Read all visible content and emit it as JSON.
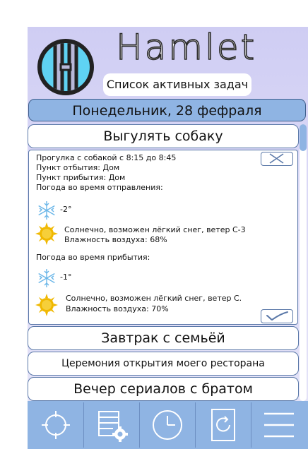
{
  "app": {
    "title": "Hamlet",
    "subtitle": "Список активных задач"
  },
  "date": "Понедельник, 28 фефраля",
  "tasks": [
    {
      "title": "Выгулять собаку",
      "expanded": true
    },
    {
      "title": "Завтрак с семьёй"
    },
    {
      "title": "Церемония открытия моего ресторана"
    },
    {
      "title": "Вечер сериалов с братом"
    }
  ],
  "details": {
    "line1": "Прогулка с собакой с 8:15 до 8:45",
    "line2": "Пункт отбытия: Дом",
    "line3": "Пункт прибытия: Дом",
    "departure_label": "Погода во время отправления:",
    "departure_temp": "-2°",
    "departure_desc": "Солнечно, возможен лёгкий снег, ветер С-3",
    "departure_humidity": "Влажность воздуха: 68%",
    "arrival_label": "Погода во время прибытия:",
    "arrival_temp": "-1°",
    "arrival_desc": "Солнечно, возможен лёгкий снег, ветер С.",
    "arrival_humidity": "Влажность воздуха: 70%"
  },
  "icons": {
    "close": "close-icon",
    "check": "checkmark-icon",
    "snow": "snowflake-icon",
    "sun": "sun-icon"
  },
  "tabbar": [
    {
      "icon": "target-icon"
    },
    {
      "icon": "task-settings-icon"
    },
    {
      "icon": "clock-icon"
    },
    {
      "icon": "refresh-icon"
    },
    {
      "icon": "menu-icon"
    }
  ],
  "colors": {
    "accent": "#8fb4e3",
    "border": "#5a78a8",
    "background_top": "#cfcdf3",
    "logo_cyan": "#5fd3f3"
  }
}
